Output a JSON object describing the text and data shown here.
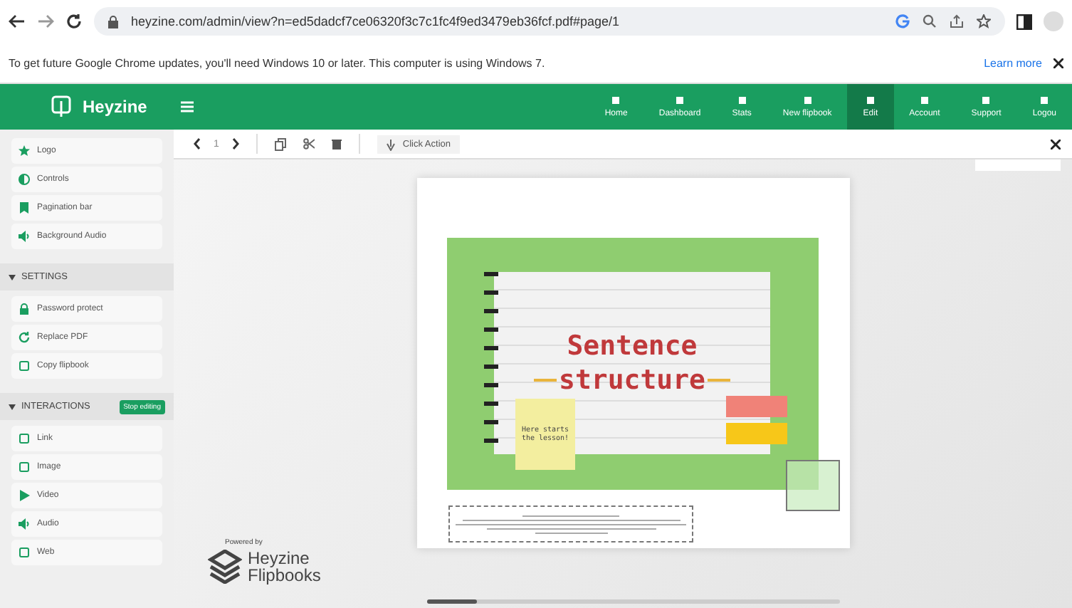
{
  "browser": {
    "url": "heyzine.com/admin/view?n=ed5dadcf7ce06320f3c7c1fc4f9ed3479eb36fcf.pdf#page/1"
  },
  "infobar": {
    "message": "To get future Google Chrome updates, you'll need Windows 10 or later. This computer is using Windows 7.",
    "link": "Learn more"
  },
  "header": {
    "brand": "Heyzine",
    "nav": [
      {
        "label": "Home",
        "selected": false
      },
      {
        "label": "Dashboard",
        "selected": false
      },
      {
        "label": "Stats",
        "selected": false
      },
      {
        "label": "New flipbook",
        "selected": false
      },
      {
        "label": "Edit",
        "selected": true
      },
      {
        "label": "Account",
        "selected": false
      },
      {
        "label": "Support",
        "selected": false
      },
      {
        "label": "Logou",
        "selected": false
      }
    ]
  },
  "sidebar": {
    "items": [
      {
        "kind": "item",
        "label": "Logo"
      },
      {
        "kind": "item",
        "label": "Controls"
      },
      {
        "kind": "item",
        "label": "Pagination bar"
      },
      {
        "kind": "item",
        "label": "Background Audio"
      },
      {
        "kind": "section",
        "label": "SETTINGS"
      },
      {
        "kind": "item",
        "label": "Password protect"
      },
      {
        "kind": "item",
        "label": "Replace PDF"
      },
      {
        "kind": "item",
        "label": "Copy flipbook"
      },
      {
        "kind": "section",
        "label": "INTERACTIONS",
        "button": "Stop editing"
      },
      {
        "kind": "item",
        "label": "Link"
      },
      {
        "kind": "item",
        "label": "Image"
      },
      {
        "kind": "item",
        "label": "Video"
      },
      {
        "kind": "item",
        "label": "Audio"
      },
      {
        "kind": "item",
        "label": "Web"
      }
    ]
  },
  "toolbar": {
    "page": "1",
    "action": "Click Action"
  },
  "slide": {
    "title_1": "Sentence",
    "title_2": "structure",
    "note": "Here starts the lesson!"
  },
  "powered": {
    "caption": "Powered by",
    "name_1": "Heyzine",
    "name_2": "Flipbooks"
  }
}
